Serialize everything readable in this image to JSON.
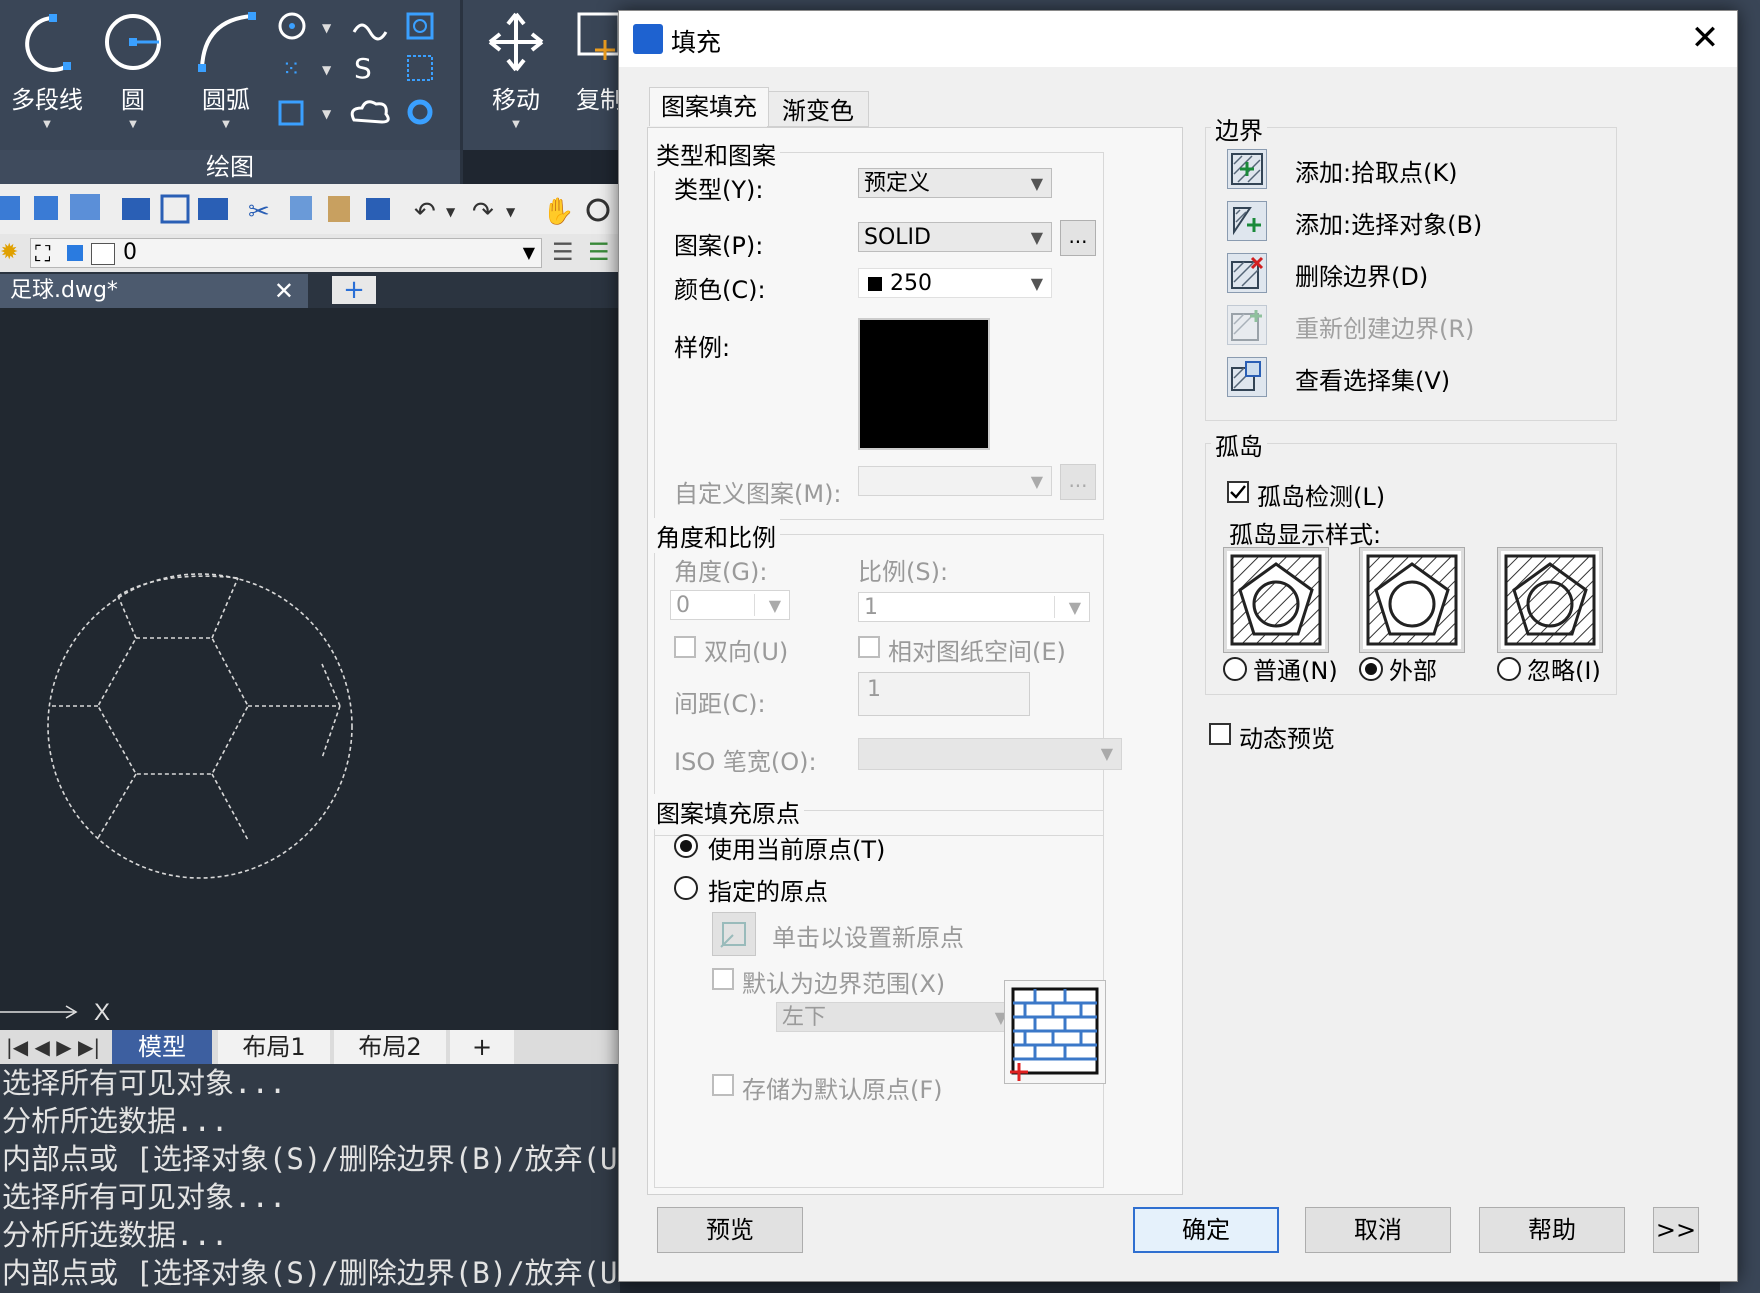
{
  "ribbon": {
    "tools": [
      "多段线",
      "圆",
      "圆弧",
      "移动",
      "复制"
    ],
    "group_label": "绘图"
  },
  "layer": {
    "current": "0"
  },
  "doc_tab": {
    "title": "足球.dwg*",
    "close": "✕",
    "new": "+"
  },
  "viewport": {
    "axis_x": "X"
  },
  "layout_tabs": {
    "items": [
      "模型",
      "布局1",
      "布局2",
      "+"
    ],
    "active": "模型"
  },
  "cmd_lines": [
    "选择所有可见对象...",
    "分析所选数据...",
    "内部点或 [选择对象(S)/删除边界(B)/放弃(U)]:",
    "选择所有可见对象...",
    "分析所选数据...",
    "内部点或 [选择对象(S)/删除边界(B)/放弃(U)]:"
  ],
  "dialog": {
    "title": "填充",
    "close": "✕",
    "tabs": [
      "图案填充",
      "渐变色"
    ],
    "type_pattern": {
      "group": "类型和图案",
      "type_label": "类型(Y):",
      "type_value": "预定义",
      "pattern_label": "图案(P):",
      "pattern_value": "SOLID",
      "color_label": "颜色(C):",
      "color_value": "250",
      "swatch_label": "样例:",
      "custom_label": "自定义图案(M):",
      "dots": "..."
    },
    "angle_scale": {
      "group": "角度和比例",
      "angle_label": "角度(G):",
      "angle_value": "0",
      "scale_label": "比例(S):",
      "scale_value": "1",
      "double_label": "双向(U)",
      "relative_label": "相对图纸空间(E)",
      "spacing_label": "间距(C):",
      "spacing_value": "1",
      "iso_label": "ISO 笔宽(O):"
    },
    "origin": {
      "group": "图案填充原点",
      "use_current": "使用当前原点(T)",
      "specified": "指定的原点",
      "click_set": "单击以设置新原点",
      "default_extent": "默认为边界范围(X)",
      "extent_value": "左下",
      "store_default": "存储为默认原点(F)"
    },
    "boundaries": {
      "group": "边界",
      "add_pick": "添加:拾取点(K)",
      "add_select": "添加:选择对象(B)",
      "remove": "删除边界(D)",
      "recreate": "重新创建边界(R)",
      "view_sel": "查看选择集(V)"
    },
    "islands": {
      "group": "孤岛",
      "detect": "孤岛检测(L)",
      "style_label": "孤岛显示样式:",
      "normal": "普通(N)",
      "outer": "外部",
      "ignore": "忽略(I)",
      "selected": "outer"
    },
    "dynamic_preview": "动态预览",
    "buttons": {
      "preview": "预览",
      "ok": "确定",
      "cancel": "取消",
      "help": "帮助",
      "more": ">>"
    }
  },
  "colors": {
    "accent": "#2f6fd0",
    "ribbon_bg": "#3a4657",
    "viewport_bg": "#212830"
  }
}
